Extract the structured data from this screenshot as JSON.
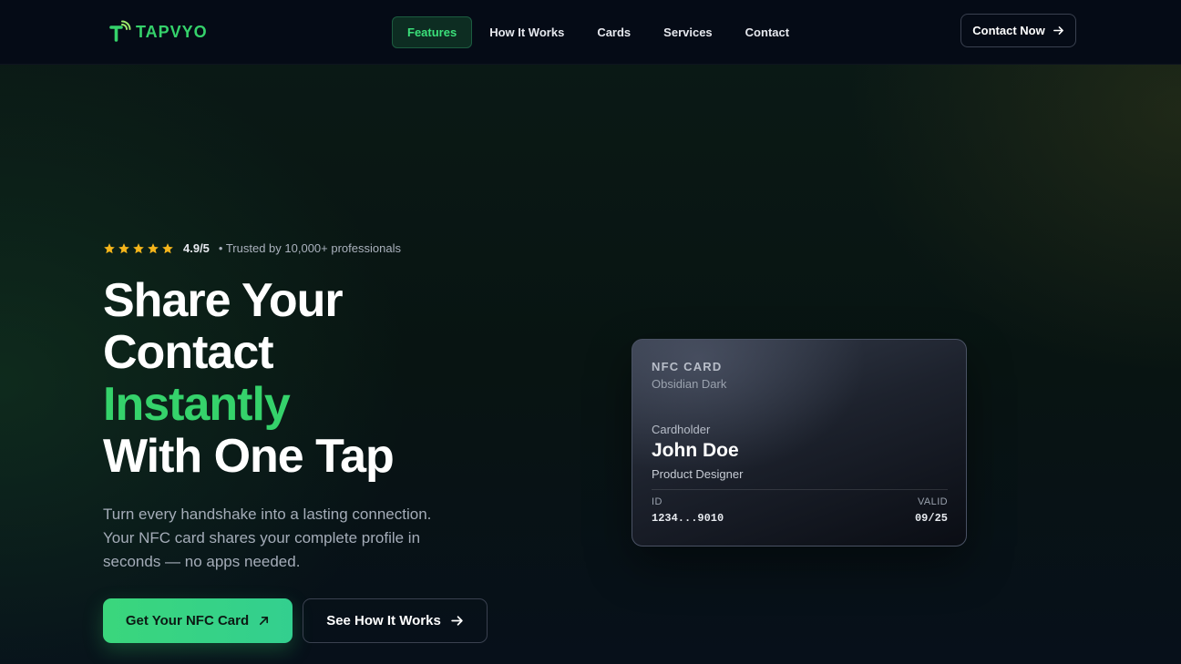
{
  "brand": {
    "name": "TAPVYO",
    "accent_color": "#35d26b",
    "logo_icon": "tap-signal-icon"
  },
  "nav": {
    "items": [
      {
        "label": "Features",
        "active": true
      },
      {
        "label": "How It Works",
        "active": false
      },
      {
        "label": "Cards",
        "active": false
      },
      {
        "label": "Services",
        "active": false
      },
      {
        "label": "Contact",
        "active": false
      }
    ],
    "cta_label": "Contact Now",
    "cta_icon": "arrow-right-icon"
  },
  "hero": {
    "rating": {
      "stars": 5,
      "star_color": "#f5b51b",
      "value": "4.9/5",
      "trust_text": "• Trusted by 10,000+ professionals"
    },
    "headline": {
      "line1": "Share Your",
      "line2": "Contact",
      "line3_accent": "Instantly",
      "line4": "With One Tap"
    },
    "subtitle": "Turn every handshake into a lasting connection. Your NFC card shares your complete profile in seconds — no apps needed.",
    "primary_button": {
      "label": "Get Your NFC Card",
      "icon": "arrow-up-right-icon"
    },
    "secondary_button": {
      "label": "See How It Works",
      "icon": "arrow-right-icon"
    }
  },
  "card": {
    "type": "NFC CARD",
    "edition": "Obsidian Dark",
    "holder_label": "Cardholder",
    "holder_name": "John Doe",
    "holder_role": "Product Designer",
    "id_label": "ID",
    "id_value": "1234...9010",
    "valid_label": "VALID",
    "valid_value": "09/25"
  }
}
